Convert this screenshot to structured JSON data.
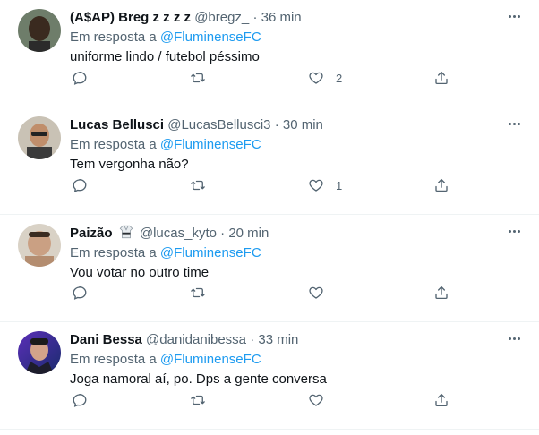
{
  "tweets": [
    {
      "display_name": "(A$AP) Breg z z z z",
      "handle": "@bregz_",
      "separator": "·",
      "time": "36 min",
      "reply_prefix": "Em resposta a",
      "reply_to": "@FluminenseFC",
      "text": "uniforme lindo / futebol péssimo",
      "like_count": "2",
      "avatar_color": "#3a2a1f"
    },
    {
      "display_name": "Lucas Bellusci",
      "handle": "@LucasBellusci3",
      "separator": "·",
      "time": "30 min",
      "reply_prefix": "Em resposta a",
      "reply_to": "@FluminenseFC",
      "text": "Tem vergonha não?",
      "like_count": "1",
      "avatar_color": "#5a4a3c"
    },
    {
      "display_name": "Paizão",
      "handle": "@lucas_kyto",
      "separator": "·",
      "time": "20 min",
      "reply_prefix": "Em resposta a",
      "reply_to": "@FluminenseFC",
      "text": "Vou votar no outro time",
      "like_count": "",
      "avatar_color": "#b98d6f"
    },
    {
      "display_name": "Dani Bessa",
      "handle": "@danidanibessa",
      "separator": "·",
      "time": "33 min",
      "reply_prefix": "Em resposta a",
      "reply_to": "@FluminenseFC",
      "text": "Joga namoral aí, po. Dps a gente conversa",
      "like_count": "",
      "avatar_color": "#1e2a6b"
    }
  ],
  "icons": {
    "reply": "reply-icon",
    "retweet": "retweet-icon",
    "like": "heart-icon",
    "share": "share-icon",
    "more": "more-icon"
  },
  "colors": {
    "accent": "#1d9bf0",
    "secondary_text": "#536471",
    "border": "#eff3f4"
  }
}
